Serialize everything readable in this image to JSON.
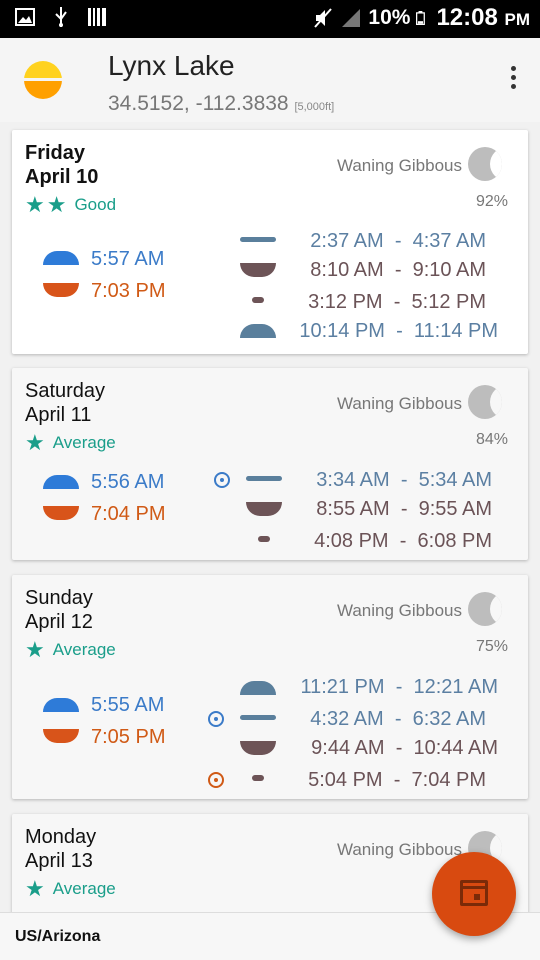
{
  "status": {
    "battery_pct": "10%",
    "time": "12:08",
    "ampm": "PM",
    "icons": [
      "image-icon",
      "usb-icon",
      "barcode-icon",
      "mute-icon",
      "signal-icon",
      "battery-icon"
    ]
  },
  "header": {
    "title": "Lynx Lake",
    "coords": "34.5152, -112.3838",
    "elevation": "[5,000ft]",
    "logo_colors": [
      "#ffd21f",
      "#ffa000"
    ]
  },
  "days": [
    {
      "day": "Friday",
      "date": "April 10",
      "stars": "★★",
      "rating": "Good",
      "phase": "Waning Gibbous",
      "illumination": "92%",
      "sunrise": "5:57 AM",
      "sunset": "7:03 PM",
      "events": [
        {
          "icon": "major-bar",
          "start": "2:37 AM",
          "sep": "-",
          "end": "4:37 AM"
        },
        {
          "icon": "moonset",
          "start": "8:10 AM",
          "sep": "-",
          "end": "9:10 AM"
        },
        {
          "icon": "minor-dot",
          "start": "3:12 PM",
          "sep": "-",
          "end": "5:12 PM"
        },
        {
          "icon": "moonrise",
          "start": "10:14 PM",
          "sep": "-",
          "end": "11:14 PM"
        }
      ]
    },
    {
      "day": "Saturday",
      "date": "April 11",
      "stars": "★",
      "rating": "Average",
      "phase": "Waning Gibbous",
      "illumination": "84%",
      "sunrise": "5:56 AM",
      "sunset": "7:04 PM",
      "events": [
        {
          "icon": "major-bar",
          "start": "3:34 AM",
          "sep": "-",
          "end": "5:34 AM"
        },
        {
          "icon": "moonset",
          "start": "8:55 AM",
          "sep": "-",
          "end": "9:55 AM"
        },
        {
          "icon": "minor-dot",
          "start": "4:08 PM",
          "sep": "-",
          "end": "6:08 PM"
        }
      ]
    },
    {
      "day": "Sunday",
      "date": "April 12",
      "stars": "★",
      "rating": "Average",
      "phase": "Waning Gibbous",
      "illumination": "75%",
      "sunrise": "5:55 AM",
      "sunset": "7:05 PM",
      "events": [
        {
          "icon": "moonrise",
          "start": "11:21 PM",
          "sep": "-",
          "end": "12:21 AM"
        },
        {
          "icon": "major-bar",
          "start": "4:32 AM",
          "sep": "-",
          "end": "6:32 AM"
        },
        {
          "icon": "moonset",
          "start": "9:44 AM",
          "sep": "-",
          "end": "10:44 AM"
        },
        {
          "icon": "minor-dot",
          "start": "5:04 PM",
          "sep": "-",
          "end": "7:04 PM"
        }
      ]
    },
    {
      "day": "Monday",
      "date": "April 13",
      "stars": "★",
      "rating": "Average",
      "phase": "Waning Gibbous"
    }
  ],
  "footer": {
    "timezone": "US/Arizona",
    "fab_icon": "calendar-icon",
    "fab_color": "#d84a10"
  }
}
